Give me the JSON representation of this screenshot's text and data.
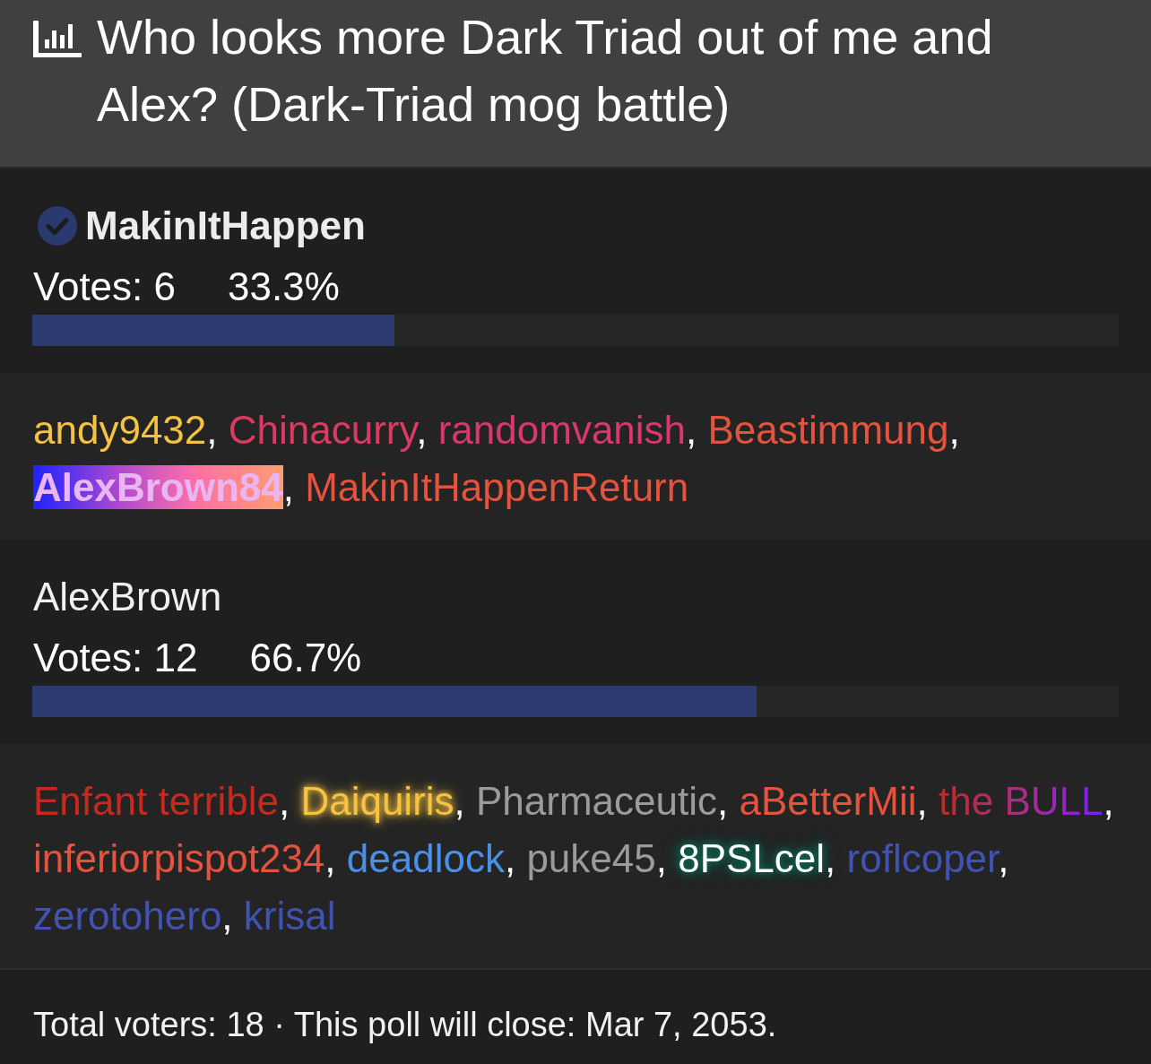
{
  "poll": {
    "title": "Who looks more Dark Triad out of me and Alex? (Dark-Triad mog battle)"
  },
  "options": [
    {
      "name": "MakinItHappen",
      "voted": true,
      "votes": "Votes: 6",
      "percent": "33.3%",
      "level": 0.333,
      "separator": ",",
      "voters": [
        {
          "name": "andy9432",
          "kind": "plain",
          "color": "#f5c242"
        },
        {
          "name": "Chinacurry",
          "kind": "plain",
          "color": "#dc3a63"
        },
        {
          "name": "randomvanish",
          "kind": "plain",
          "color": "#d8386c"
        },
        {
          "name": "Beastimmung",
          "kind": "plain",
          "color": "#e5533f"
        },
        {
          "name": "AlexBrown84",
          "kind": "highlight"
        },
        {
          "name": "MakinItHappenReturn",
          "kind": "plain",
          "color": "#e5533f"
        }
      ]
    },
    {
      "name": "AlexBrown",
      "voted": false,
      "votes": "Votes: 12",
      "percent": "66.7%",
      "level": 0.667,
      "separator": ",",
      "voters": [
        {
          "name": "Enfant terrible",
          "kind": "plain",
          "color": "#c8291f"
        },
        {
          "name": "Daiquiris",
          "kind": "glow",
          "color": "#f5c242"
        },
        {
          "name": "Pharmaceutic",
          "kind": "plain",
          "color": "#9b9b9b"
        },
        {
          "name": "aBetterMii",
          "kind": "plain",
          "color": "#e5533f"
        },
        {
          "name": "the BULL",
          "kind": "gradient"
        },
        {
          "name": "inferiorpispot234",
          "kind": "plain",
          "color": "#e5533f"
        },
        {
          "name": "deadlock",
          "kind": "plain",
          "color": "#4a90e8"
        },
        {
          "name": "puke45",
          "kind": "plain",
          "color": "#9b9b9b"
        },
        {
          "name": "8PSLcel",
          "kind": "aura",
          "color": "#ffffff"
        },
        {
          "name": "roflcoper",
          "kind": "plain",
          "color": "#4152b2"
        },
        {
          "name": "zerotohero",
          "kind": "plain",
          "color": "#4152b2"
        },
        {
          "name": "krisal",
          "kind": "plain",
          "color": "#4152b2"
        }
      ]
    }
  ],
  "footer": {
    "text": "Total voters: 18 · This poll will close: Mar 7, 2053."
  }
}
